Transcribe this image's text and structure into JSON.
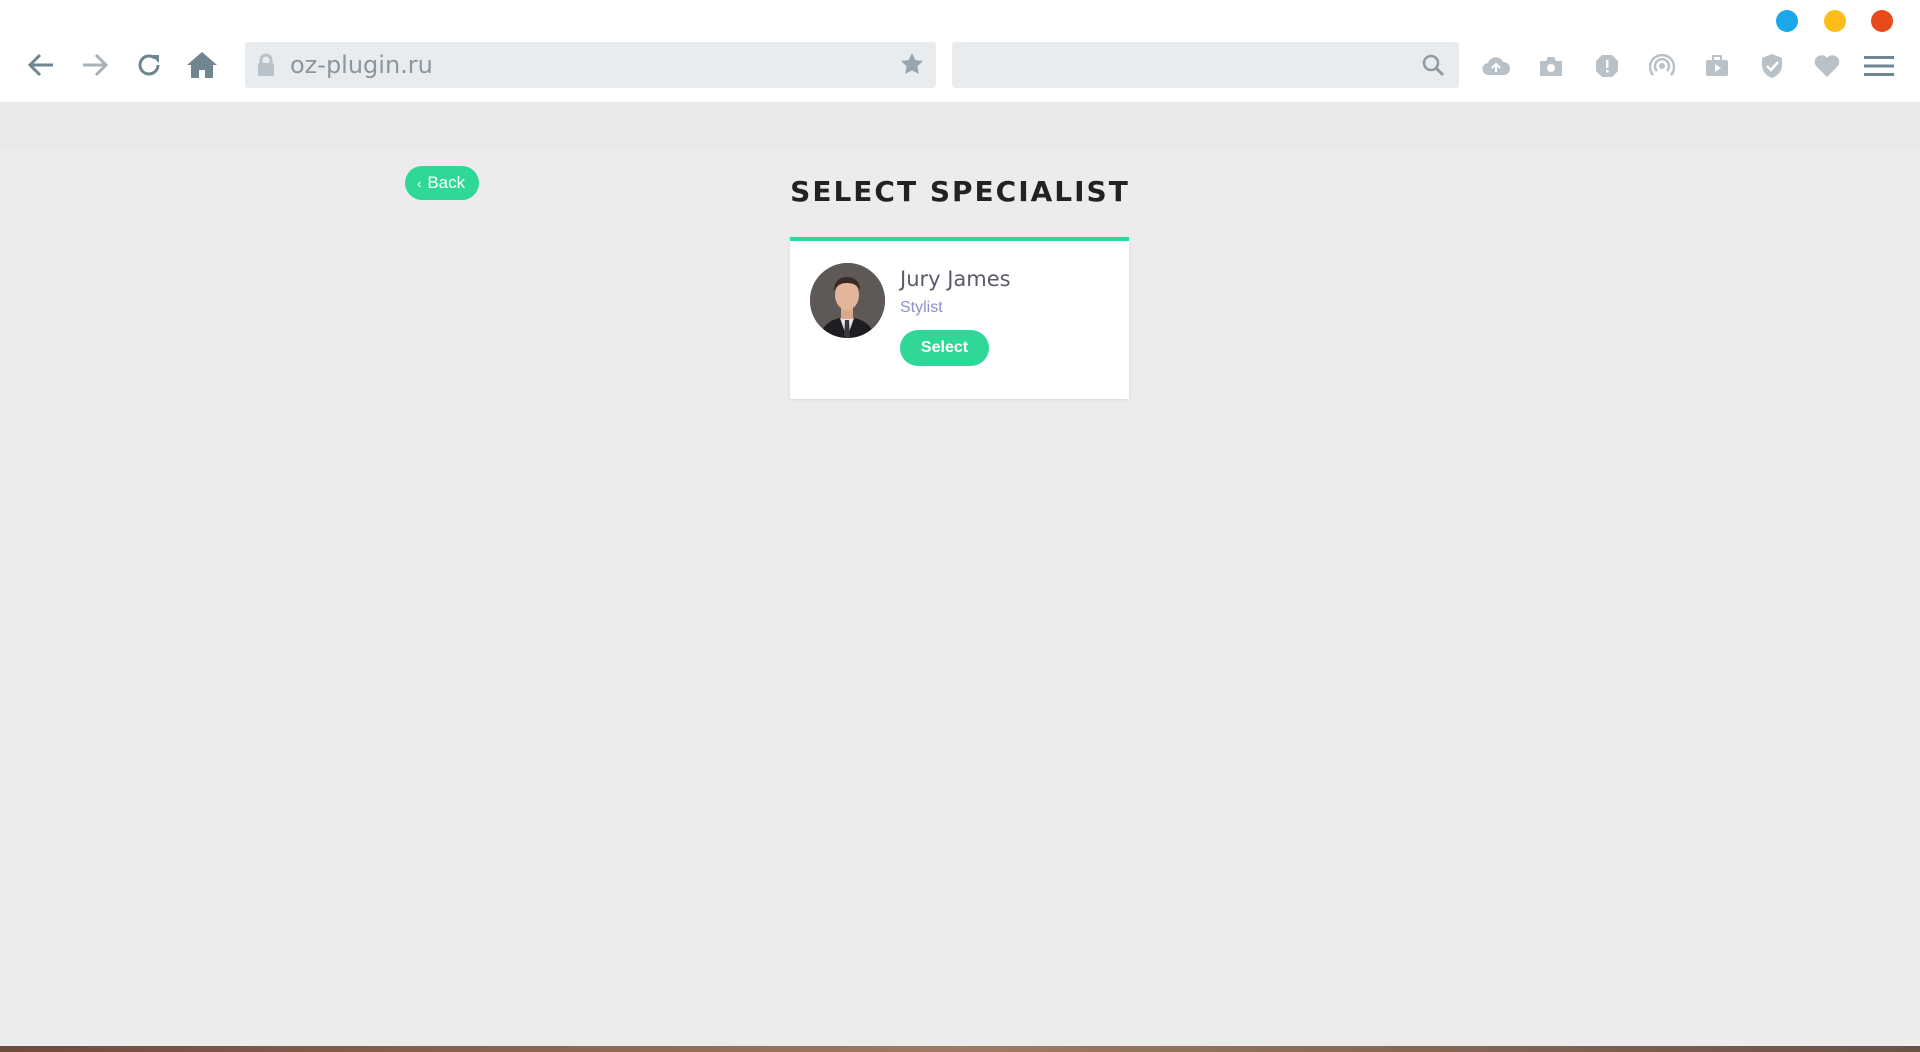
{
  "browser": {
    "url": "oz-plugin.ru",
    "search_placeholder": "",
    "window_controls": {
      "minimize_color": "#1aa7ec",
      "maximize_color": "#ffbd1a",
      "close_color": "#e84a1b"
    },
    "nav_icons": [
      "back-arrow-icon",
      "forward-arrow-icon",
      "reload-icon",
      "home-icon"
    ],
    "toolbar_icons": [
      "cloud-upload-icon",
      "camera-icon",
      "alert-icon",
      "broadcast-icon",
      "video-icon",
      "shield-check-icon",
      "heart-icon",
      "menu-icon"
    ]
  },
  "page": {
    "back_label": "Back",
    "title": "SELECT SPECIALIST",
    "accent_color": "#2fd897"
  },
  "specialist": {
    "name": "Jury James",
    "role": "Stylist",
    "select_label": "Select"
  }
}
